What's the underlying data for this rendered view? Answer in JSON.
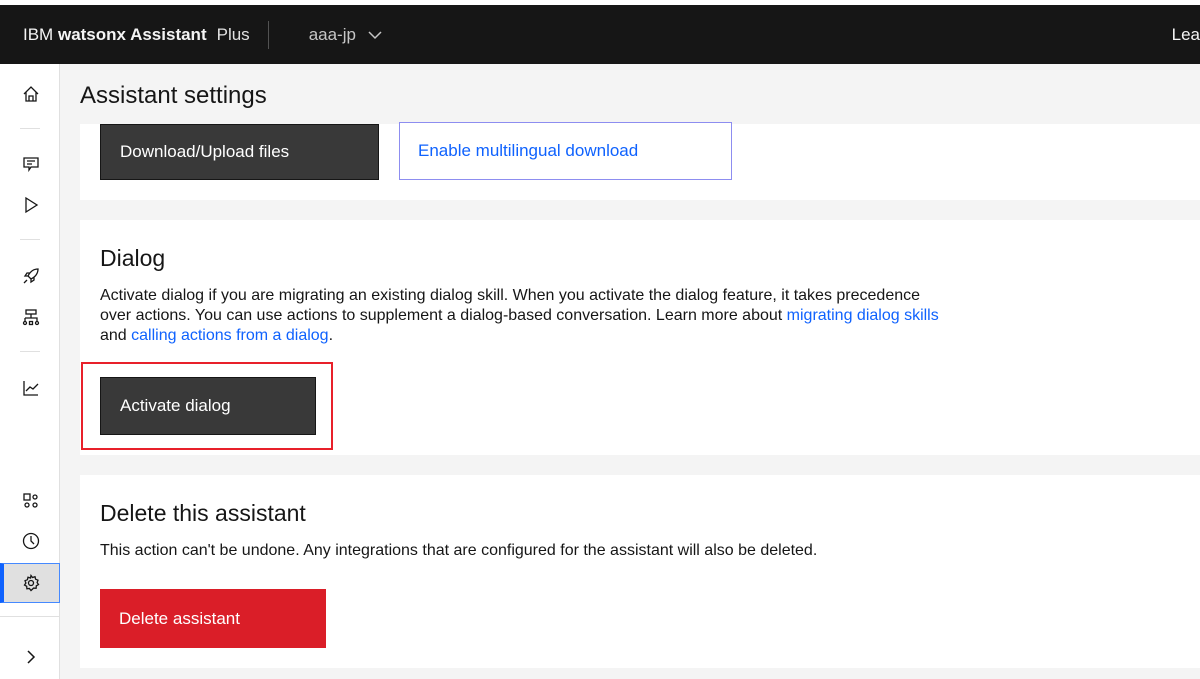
{
  "header": {
    "brand_prefix": "IBM",
    "brand_name": "watsonx Assistant",
    "plan": "Plus",
    "workspace": "aaa-jp",
    "right_text": "Lea"
  },
  "page": {
    "title": "Assistant settings"
  },
  "download": {
    "button": "Download/Upload files",
    "multilingual": "Enable multilingual download"
  },
  "dialog": {
    "title": "Dialog",
    "desc_1": "Activate dialog if you are migrating an existing dialog skill. When you activate the dialog feature, it takes precedence over actions. You can use actions to supplement a dialog-based conversation. Learn more about ",
    "link_1": "migrating dialog skills",
    "desc_2": " and ",
    "link_2": "calling actions from a dialog",
    "desc_3": ".",
    "button": "Activate dialog"
  },
  "delete": {
    "title": "Delete this assistant",
    "desc": "This action can't be undone. Any integrations that are configured for the assistant will also be deleted.",
    "button": "Delete assistant"
  },
  "colors": {
    "header": "#161616",
    "accent": "#0f62fe",
    "danger": "#da1e28",
    "highlight": "#e8202a"
  }
}
